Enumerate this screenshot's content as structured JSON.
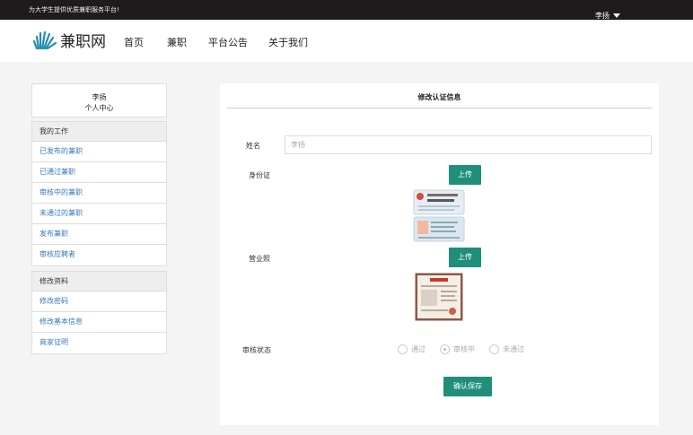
{
  "topbar": {
    "slogan": "为大学生提供优质兼职服务平台!",
    "username": "李扬"
  },
  "logo": {
    "text": "兼职网",
    "color": "#1f8fb0"
  },
  "nav": {
    "items": [
      "首页",
      "兼职",
      "平台公告",
      "关于我们"
    ]
  },
  "profile": {
    "name": "李扬",
    "subtitle": "个人中心"
  },
  "menu_work": {
    "title": "我的工作",
    "items": [
      "已发布的兼职",
      "已通过兼职",
      "审核中的兼职",
      "未通过的兼职",
      "发布兼职",
      "审核应聘者"
    ]
  },
  "menu_profile": {
    "title": "修改资料",
    "items": [
      "修改密码",
      "修改基本信息",
      "商家证明"
    ]
  },
  "form": {
    "title": "修改认证信息",
    "name_label": "姓名",
    "name_placeholder": "李扬",
    "id_label": "身份证",
    "license_label": "营业照",
    "upload_label": "上传",
    "status_label": "审核状态",
    "status_options": [
      "通过",
      "审核中",
      "未通过"
    ],
    "status_selected": "审核中",
    "submit_label": "确认保存"
  },
  "colors": {
    "accent": "#1f8f7a",
    "link": "#3a78b8",
    "topbar": "#1f1a1c"
  }
}
